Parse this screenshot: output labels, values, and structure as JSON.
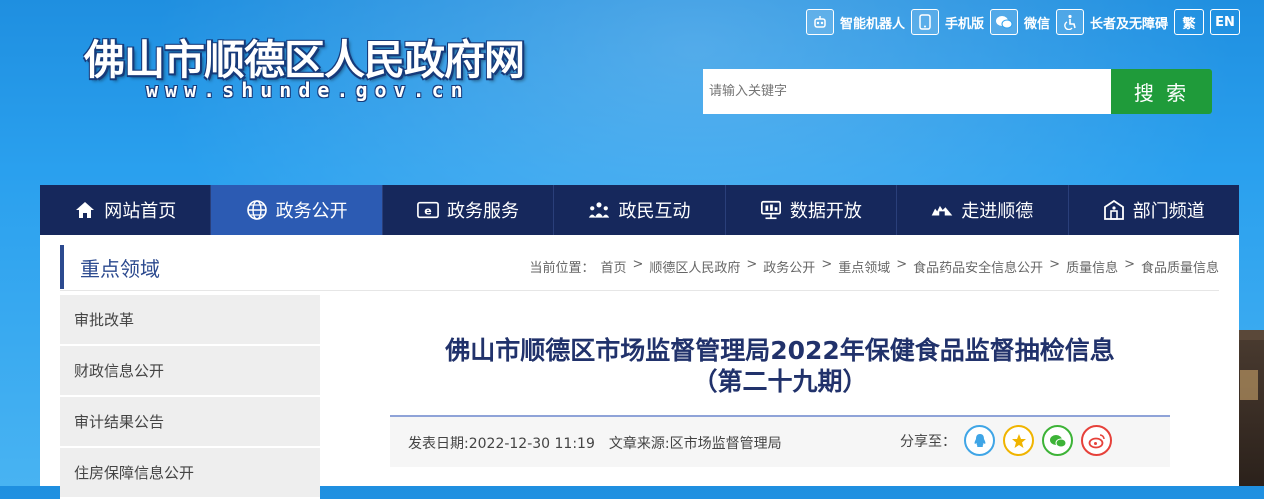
{
  "header": {
    "site_title": "佛山市顺德区人民政府网",
    "site_url": "www.shunde.gov.cn",
    "utilities": [
      {
        "label": "智能机器人",
        "icon": "robot-icon"
      },
      {
        "label": "手机版",
        "icon": "phone-icon"
      },
      {
        "label": "微信",
        "icon": "wechat-icon"
      },
      {
        "label": "长者及无障碍",
        "icon": "accessibility-icon"
      }
    ],
    "traditional_label": "繁",
    "english_label": "EN"
  },
  "search": {
    "placeholder": "请输入关键字",
    "button_label": "搜 索"
  },
  "nav": {
    "items": [
      {
        "label": "网站首页",
        "icon": "home-icon"
      },
      {
        "label": "政务公开",
        "icon": "globe-icon",
        "active": true
      },
      {
        "label": "政务服务",
        "icon": "service-icon"
      },
      {
        "label": "政民互动",
        "icon": "people-icon"
      },
      {
        "label": "数据开放",
        "icon": "data-icon"
      },
      {
        "label": "走进顺德",
        "icon": "landscape-icon"
      },
      {
        "label": "部门频道",
        "icon": "department-icon"
      }
    ]
  },
  "sidebar": {
    "heading": "重点领域",
    "items": [
      {
        "label": "审批改革"
      },
      {
        "label": "财政信息公开"
      },
      {
        "label": "审计结果公告"
      },
      {
        "label": "住房保障信息公开"
      }
    ]
  },
  "breadcrumb": {
    "prefix": "当前位置：",
    "items": [
      "首页",
      "顺德区人民政府",
      "政务公开",
      "重点领域",
      "食品药品安全信息公开",
      "质量信息",
      "食品质量信息"
    ],
    "separator": ">"
  },
  "article": {
    "title_line1": "佛山市顺德区市场监督管理局2022年保健食品监督抽检信息",
    "title_line2": "（第二十九期）",
    "publish_date": "发表日期:2022-12-30 11:19",
    "source": "文章来源:区市场监督管理局",
    "share_label": "分享至："
  },
  "colors": {
    "nav_bg": "#16285c",
    "nav_active": "#2c5bb3",
    "search_button": "#1f9b3a",
    "title_color": "#21326b"
  }
}
